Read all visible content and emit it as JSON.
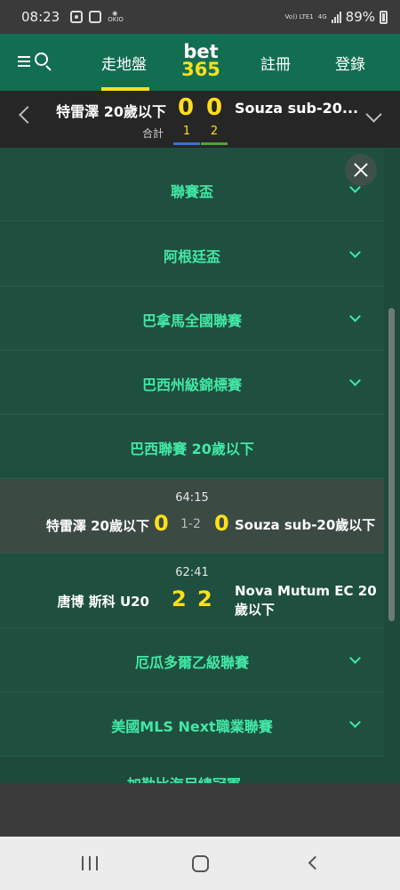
{
  "status_bar": {
    "time": "08:23",
    "network": "Vo)) LTE1",
    "signal_type": "4G",
    "battery": "89%",
    "app_icons": [
      "notification-icon",
      "gallery-icon",
      "radio-icon"
    ]
  },
  "header": {
    "logo_top": "bet",
    "logo_bottom": "365",
    "nav_live": "走地盤",
    "nav_register": "註冊",
    "nav_login": "登錄",
    "accent_color": "#ffdf1b",
    "brand_color": "#126e51"
  },
  "match_bar": {
    "home_team": "特雷澤 20歲以下",
    "away_team": "Souza sub-20...",
    "home_score": "0",
    "away_score": "0",
    "total_label": "合計",
    "home_total": "1",
    "away_total": "2"
  },
  "competitions": [
    {
      "label": "聯賽盃"
    },
    {
      "label": "阿根廷盃"
    },
    {
      "label": "巴拿馬全國聯賽"
    },
    {
      "label": "巴西州級錦標賽"
    },
    {
      "label": "巴西聯賽 20歲以下"
    }
  ],
  "matches": [
    {
      "time": "64:15",
      "home": "特雷澤 20歲以下",
      "home_score": "0",
      "middle": "1-2",
      "away_score": "0",
      "away": "Souza sub-20歲以下"
    },
    {
      "time": "62:41",
      "home": "唐博 斯科 U20",
      "home_score": "2",
      "middle": "",
      "away_score": "2",
      "away": "Nova Mutum EC 20歲以下"
    }
  ],
  "competitions_after": [
    {
      "label": "厄瓜多爾乙級聯賽"
    },
    {
      "label": "美國MLS Next職業聯賽"
    },
    {
      "label": "加勒比海足總冠軍..."
    }
  ]
}
